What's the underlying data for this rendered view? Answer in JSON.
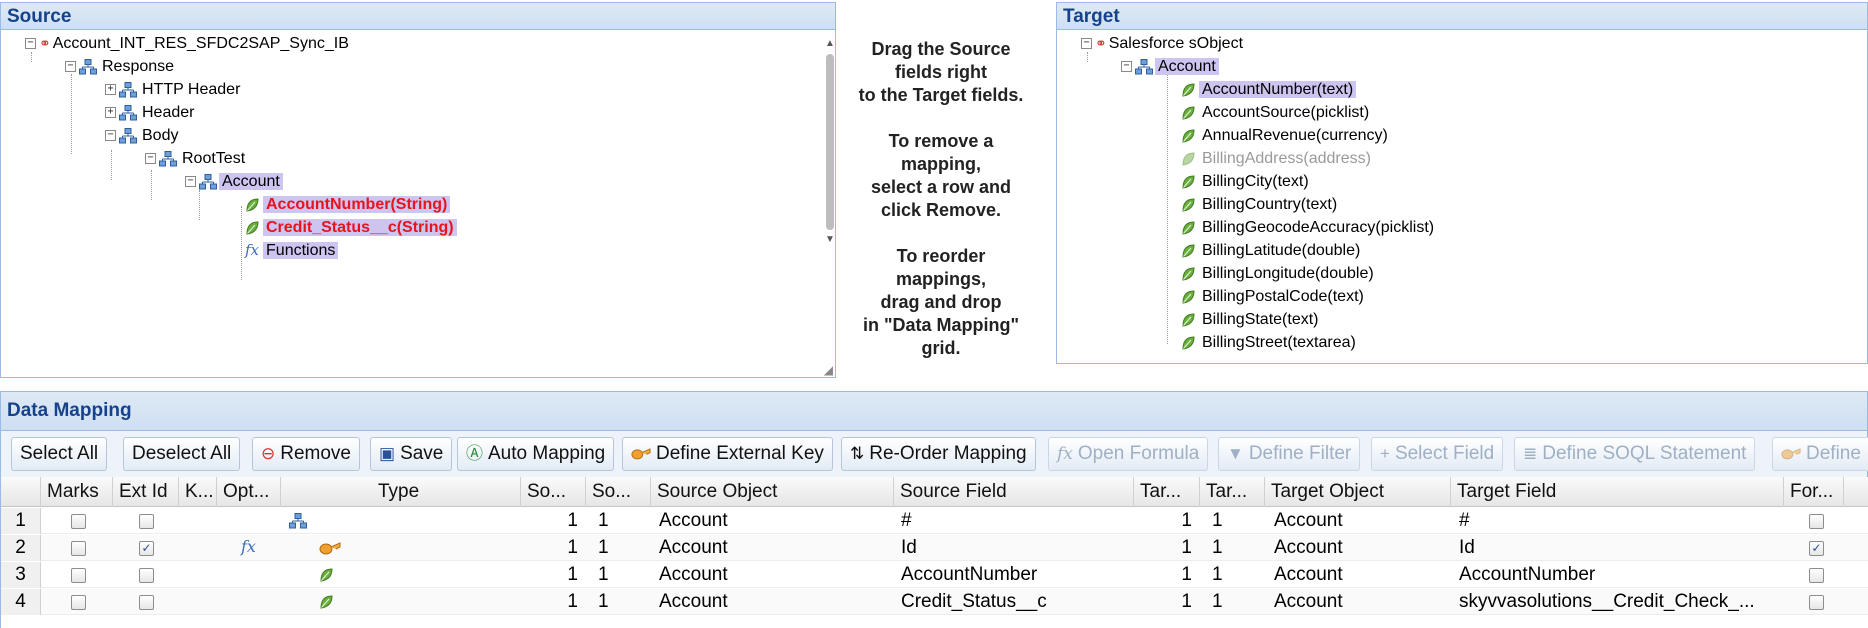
{
  "source": {
    "title": "Source",
    "tree": {
      "root": "Account_INT_RES_SFDC2SAP_Sync_IB",
      "response": "Response",
      "http_header": "HTTP Header",
      "header": "Header",
      "body": "Body",
      "roottest": "RootTest",
      "account": "Account",
      "field1": "AccountNumber(String)",
      "field2": "Credit_Status__c(String)",
      "functions": "Functions"
    }
  },
  "hint": {
    "p1": [
      "Drag the Source",
      "fields right",
      "to the Target fields."
    ],
    "p2": [
      "To remove a",
      "mapping,",
      "select a row and",
      "click Remove."
    ],
    "p3": [
      "To reorder",
      "mappings,",
      "drag and drop",
      "in \"Data Mapping\"",
      "grid."
    ]
  },
  "target": {
    "title": "Target",
    "root": "Salesforce sObject",
    "account": "Account",
    "fields": [
      "AccountNumber(text)",
      "AccountSource(picklist)",
      "AnnualRevenue(currency)",
      "BillingAddress(address)",
      "BillingCity(text)",
      "BillingCountry(text)",
      "BillingGeocodeAccuracy(picklist)",
      "BillingLatitude(double)",
      "BillingLongitude(double)",
      "BillingPostalCode(text)",
      "BillingState(text)",
      "BillingStreet(textarea)"
    ]
  },
  "mapping": {
    "title": "Data Mapping",
    "toolbar": {
      "select_all": "Select All",
      "deselect_all": "Deselect All",
      "remove": "Remove",
      "save": "Save",
      "auto_mapping": "Auto Mapping",
      "define_external_key": "Define External Key",
      "reorder_mapping": "Re-Order Mapping",
      "open_formula": "Open Formula",
      "define_filter": "Define Filter",
      "select_field": "Select Field",
      "define_soql": "Define SOQL Statement",
      "define_last": "Define I"
    },
    "columns": {
      "marks": "Marks",
      "ext_id": "Ext Id",
      "k": "K...",
      "opt": "Opt...",
      "type": "Type",
      "so1": "So...",
      "so2": "So...",
      "source_object": "Source Object",
      "source_field": "Source Field",
      "tar1": "Tar...",
      "tar2": "Tar...",
      "target_object": "Target Object",
      "target_field": "Target Field",
      "for": "For..."
    },
    "rows": [
      {
        "n": "1",
        "s1": "1",
        "s2": "1",
        "source_object": "Account",
        "source_field": "#",
        "t1": "1",
        "t2": "1",
        "target_object": "Account",
        "target_field": "#"
      },
      {
        "n": "2",
        "s1": "1",
        "s2": "1",
        "source_object": "Account",
        "source_field": "Id",
        "t1": "1",
        "t2": "1",
        "target_object": "Account",
        "target_field": "Id"
      },
      {
        "n": "3",
        "s1": "1",
        "s2": "1",
        "source_object": "Account",
        "source_field": "AccountNumber",
        "t1": "1",
        "t2": "1",
        "target_object": "Account",
        "target_field": "AccountNumber"
      },
      {
        "n": "4",
        "s1": "1",
        "s2": "1",
        "source_object": "Account",
        "source_field": "Credit_Status__c",
        "t1": "1",
        "t2": "1",
        "target_object": "Account",
        "target_field": "skyvvasolutions__Credit_Check_..."
      }
    ]
  }
}
